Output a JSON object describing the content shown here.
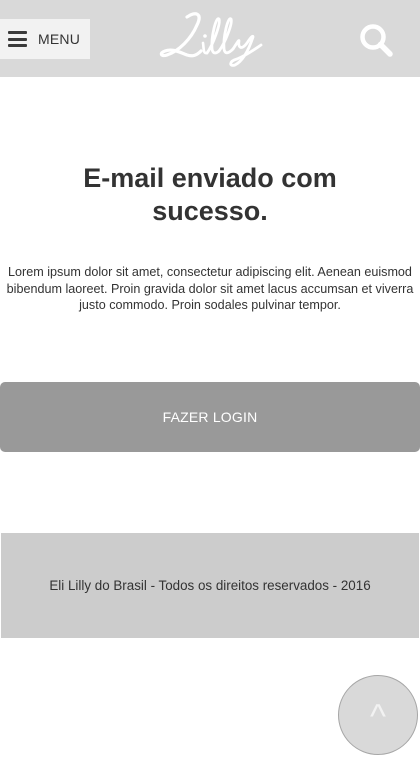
{
  "header": {
    "menu_label": "MENU",
    "logo_text": "Lilly",
    "menu_icon": "hamburger-icon",
    "search_icon": "search-icon",
    "background_color": "#d9d9d9"
  },
  "main": {
    "title": "E-mail enviado com sucesso.",
    "description": "Lorem ipsum dolor sit amet, consectetur adipiscing elit. Aenean euismod bibendum laoreet. Proin gravida dolor sit amet lacus accumsan et viverra justo commodo. Proin sodales pulvinar tempor.",
    "login_button_label": "FAZER LOGIN",
    "login_button_color": "#999999"
  },
  "footer": {
    "copyright": "Eli Lilly do Brasil - Todos os direitos reservados - 2016",
    "background_color": "#cccccc"
  },
  "back_to_top": {
    "label": "^",
    "icon": "chevron-up-icon"
  }
}
